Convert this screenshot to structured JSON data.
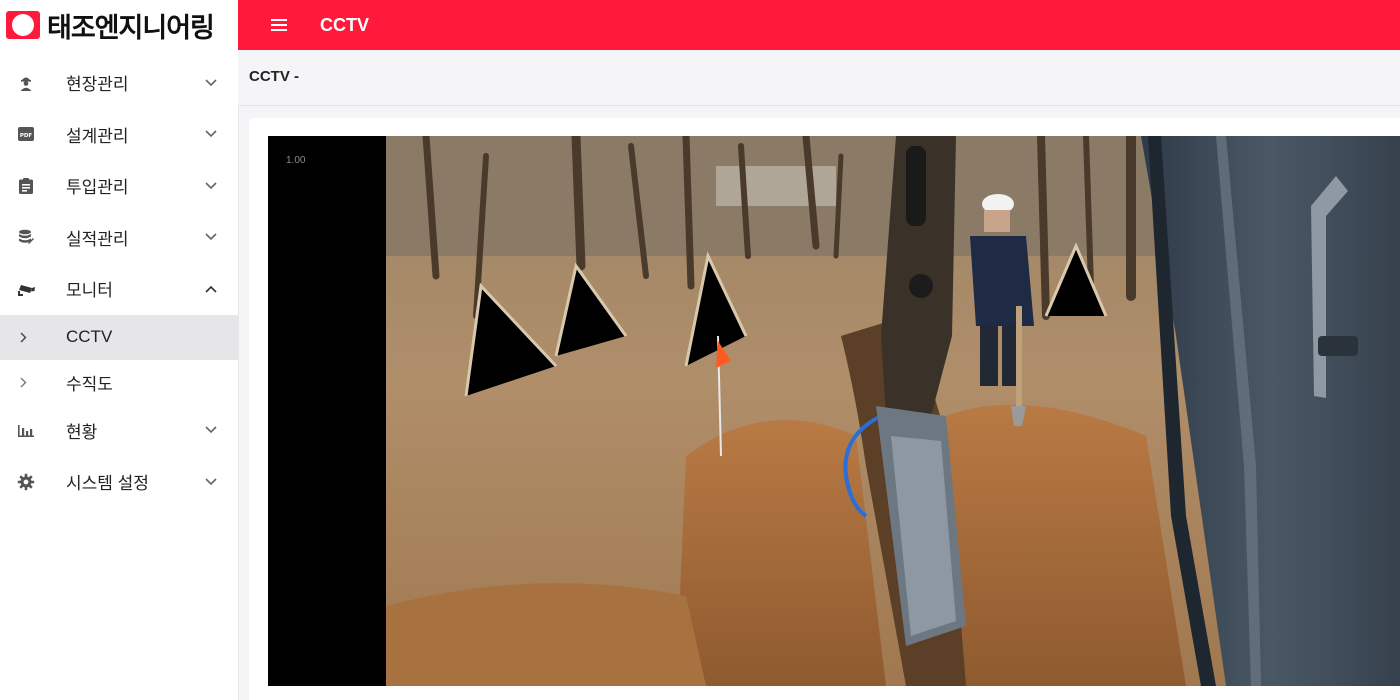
{
  "brand": {
    "name": "태조엔지니어링",
    "accent_color": "#ff1a3c",
    "logo_icon": "brand-logo-icon"
  },
  "header": {
    "title": "CCTV",
    "menu_icon": "hamburger-menu-icon"
  },
  "sidebar": {
    "items": [
      {
        "label": "현장관리",
        "icon": "worker-icon",
        "expanded": false
      },
      {
        "label": "설계관리",
        "icon": "pdf-icon",
        "expanded": false
      },
      {
        "label": "투입관리",
        "icon": "clipboard-icon",
        "expanded": false
      },
      {
        "label": "실적관리",
        "icon": "database-icon",
        "expanded": false
      },
      {
        "label": "모니터",
        "icon": "cctv-camera-icon",
        "expanded": true,
        "children": [
          {
            "label": "CCTV",
            "active": true
          },
          {
            "label": "수직도",
            "active": false
          }
        ]
      },
      {
        "label": "현황",
        "icon": "bar-chart-icon",
        "expanded": false
      },
      {
        "label": "시스템 설정",
        "icon": "gear-icon",
        "expanded": false
      }
    ]
  },
  "breadcrumb": "CCTV -",
  "player": {
    "speed": "1.00"
  }
}
